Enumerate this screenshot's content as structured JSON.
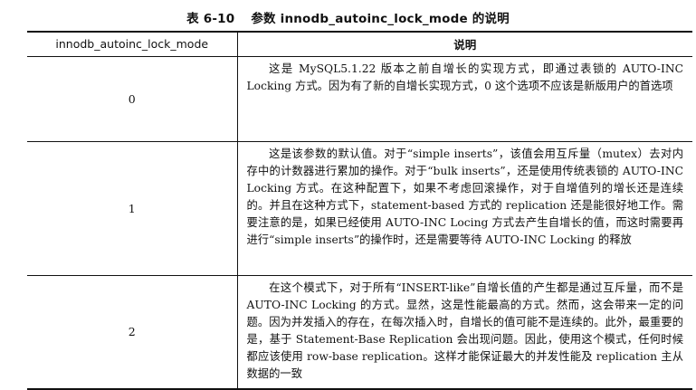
{
  "caption": {
    "number": "表 6-10",
    "title": "参数 innodb_autoinc_lock_mode 的说明"
  },
  "table": {
    "headers": [
      "innodb_autoinc_lock_mode",
      "说明"
    ],
    "rows": [
      {
        "mode": "0",
        "description": "这是 MySQL5.1.22 版本之前自增长的实现方式，即通过表锁的 AUTO-INC Locking 方式。因为有了新的自增长实现方式，0 这个选项不应该是新版用户的首选项"
      },
      {
        "mode": "1",
        "description": "这是该参数的默认值。对于“simple inserts”，该值会用互斥量（mutex）去对内存中的计数器进行累加的操作。对于“bulk inserts”，还是使用传统表锁的 AUTO-INC Locking 方式。在这种配置下，如果不考虑回滚操作，对于自增值列的增长还是连续的。并且在这种方式下，statement-based 方式的 replication 还是能很好地工作。需要注意的是，如果已经使用 AUTO-INC Locing 方式去产生自增长的值，而这时需要再进行“simple inserts”的操作时，还是需要等待 AUTO-INC Locking 的释放"
      },
      {
        "mode": "2",
        "description": "在这个模式下，对于所有“INSERT-like”自增长值的产生都是通过互斥量，而不是 AUTO-INC Locking 的方式。显然，这是性能最高的方式。然而，这会带来一定的问题。因为并发插入的存在，在每次插入时，自增长的值可能不是连续的。此外，最重要的是，基于 Statement-Base Replication 会出现问题。因此，使用这个模式，任何时候都应该使用 row-base replication。这样才能保证最大的并发性能及 replication 主从数据的一致"
      }
    ]
  }
}
